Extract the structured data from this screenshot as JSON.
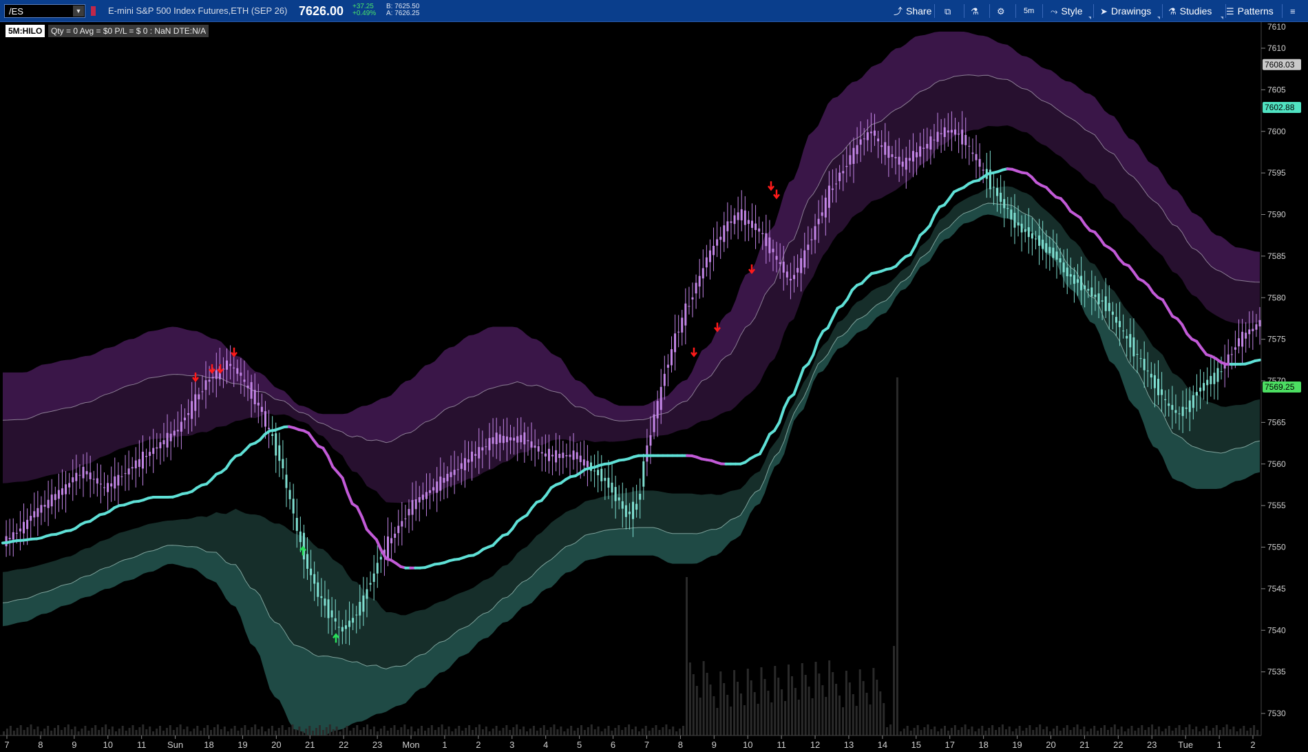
{
  "toolbar": {
    "symbol": "/ES",
    "description": "E-mini S&P 500 Index Futures,ETH (SEP 26)",
    "last_price": "7626.00",
    "net_change": "+37.25",
    "pct_change": "+0.49%",
    "bid": "B: 7625.50",
    "ask": "A: 7626.25",
    "buttons": {
      "share": "Share",
      "timeframe": "5m",
      "style": "Style",
      "drawings": "Drawings",
      "studies": "Studies",
      "patterns": "Patterns"
    }
  },
  "chart_header": {
    "study_label": "5M:HILO",
    "position_summary": "Qty = 0  Avg = $0  P/L = $ 0  : NaN  DTE:N/A"
  },
  "price_axis": {
    "ticks": [
      "7610",
      "7605",
      "7600",
      "7595",
      "7590",
      "7585",
      "7580",
      "7575",
      "7570",
      "7565",
      "7560",
      "7555",
      "7550",
      "7545",
      "7540",
      "7535",
      "7530"
    ],
    "top_tick": "7610",
    "bubbles": [
      {
        "text": "7608.03",
        "value": 7608.03,
        "bg": "#c9c9c9",
        "fg": "#000000"
      },
      {
        "text": "7602.88",
        "value": 7602.88,
        "bg": "#50e3c2",
        "fg": "#000000"
      },
      {
        "text": "7569.25",
        "value": 7569.25,
        "bg": "#4cde62",
        "fg": "#000000"
      }
    ]
  },
  "time_axis": {
    "labels": [
      "7",
      "8",
      "9",
      "10",
      "11",
      "Sun",
      "18",
      "19",
      "20",
      "21",
      "22",
      "23",
      "Mon",
      "1",
      "2",
      "3",
      "4",
      "5",
      "6",
      "7",
      "8",
      "9",
      "10",
      "11",
      "12",
      "13",
      "14",
      "15",
      "17",
      "18",
      "19",
      "20",
      "21",
      "22",
      "23",
      "Tue",
      "1",
      "2"
    ]
  },
  "chart_data": {
    "type": "line",
    "title": "",
    "ylim": [
      7526,
      7612
    ],
    "grid": false,
    "series": [
      {
        "values": [
          7550.5,
          7551.5,
          7552.5,
          7554,
          7555,
          7556,
          7557,
          7558.5,
          7559,
          7558,
          7557,
          7558,
          7559,
          7560,
          7561,
          7562,
          7563,
          7564,
          7566,
          7568,
          7570,
          7571,
          7572,
          7571,
          7569,
          7567,
          7564,
          7561,
          7556,
          7551,
          7547,
          7544,
          7542,
          7540,
          7541,
          7543,
          7546,
          7549,
          7551,
          7553,
          7555,
          7556,
          7557,
          7558,
          7559,
          7560,
          7561,
          7562,
          7563,
          7563,
          7563,
          7563,
          7562,
          7561,
          7561,
          7561,
          7561,
          7560,
          7559,
          7558,
          7556,
          7554,
          7555,
          7562,
          7567,
          7572,
          7576,
          7579,
          7582,
          7585,
          7587,
          7589,
          7590,
          7589,
          7588,
          7586,
          7584,
          7582,
          7584,
          7587,
          7590,
          7593,
          7595,
          7597,
          7599,
          7600,
          7598,
          7597,
          7596,
          7597,
          7598,
          7599,
          7600,
          7600,
          7599,
          7597,
          7595,
          7593,
          7591,
          7589,
          7588,
          7587,
          7586,
          7585,
          7583,
          7582,
          7581,
          7580,
          7579,
          7577,
          7575,
          7573,
          7571,
          7569,
          7567,
          7566,
          7567,
          7569,
          7570,
          7571,
          7573,
          7575,
          7576,
          7577
        ]
      },
      {
        "values": [
          7550.5,
          7550.8,
          7551.0,
          7551.5,
          7552.0,
          7553.0,
          7554.0,
          7555.0,
          7555.5,
          7556.0,
          7556.0,
          7556.5,
          7557.5,
          7559.0,
          7561.0,
          7562.5,
          7564.0,
          7564.5,
          7564.0,
          7562.0,
          7559.0,
          7555.0,
          7551.5,
          7548.5,
          7547.5,
          7547.5,
          7548.0,
          7548.5,
          7549.0,
          7550.0,
          7551.5,
          7553.5,
          7555.5,
          7557.5,
          7558.5,
          7559.5,
          7560.0,
          7560.5,
          7561.0,
          7561.0,
          7561.0,
          7561.0,
          7560.5,
          7560.0,
          7560.0,
          7561.0,
          7564.0,
          7568.0,
          7572.0,
          7576.0,
          7579.0,
          7581.5,
          7583.0,
          7583.5,
          7585.0,
          7588.0,
          7591.0,
          7593.0,
          7594.0,
          7595.0,
          7595.5,
          7595.0,
          7593.5,
          7592.0,
          7590.0,
          7588.0,
          7586.0,
          7584.0,
          7582.0,
          7580.0,
          7577.5,
          7575.0,
          7573.0,
          7572.0,
          7572.0,
          7572.5
        ]
      },
      {
        "values": [
          7571,
          7571,
          7572,
          7572.5,
          7573,
          7574,
          7575,
          7576,
          7576.5,
          7576,
          7575,
          7573,
          7571,
          7569,
          7567,
          7566,
          7566,
          7567,
          7568,
          7570,
          7572,
          7574,
          7575.5,
          7576.5,
          7576.5,
          7575,
          7573,
          7570,
          7568,
          7567,
          7567,
          7568,
          7570,
          7574,
          7578,
          7583,
          7588,
          7594,
          7600,
          7604,
          7606,
          7608,
          7610,
          7611.5,
          7612,
          7612,
          7611.5,
          7610.5,
          7609,
          7607.5,
          7606,
          7604.5,
          7602,
          7599,
          7596,
          7593,
          7590,
          7587.5,
          7586,
          7585.5
        ]
      },
      {
        "values": [
          7540.5,
          7541,
          7542,
          7543,
          7544,
          7545,
          7546,
          7547,
          7548,
          7547.5,
          7546,
          7543,
          7538,
          7532,
          7528,
          7527,
          7528,
          7529,
          7530,
          7531,
          7533,
          7535,
          7537,
          7539,
          7541,
          7543,
          7545,
          7547,
          7548.5,
          7549,
          7549,
          7549,
          7548,
          7548,
          7549,
          7551,
          7555,
          7560,
          7566,
          7571,
          7574,
          7576,
          7578,
          7581,
          7584,
          7587,
          7589,
          7590,
          7589.5,
          7588,
          7585,
          7581,
          7577,
          7572,
          7567,
          7562,
          7558,
          7557,
          7557,
          7558,
          7559
        ]
      }
    ]
  }
}
